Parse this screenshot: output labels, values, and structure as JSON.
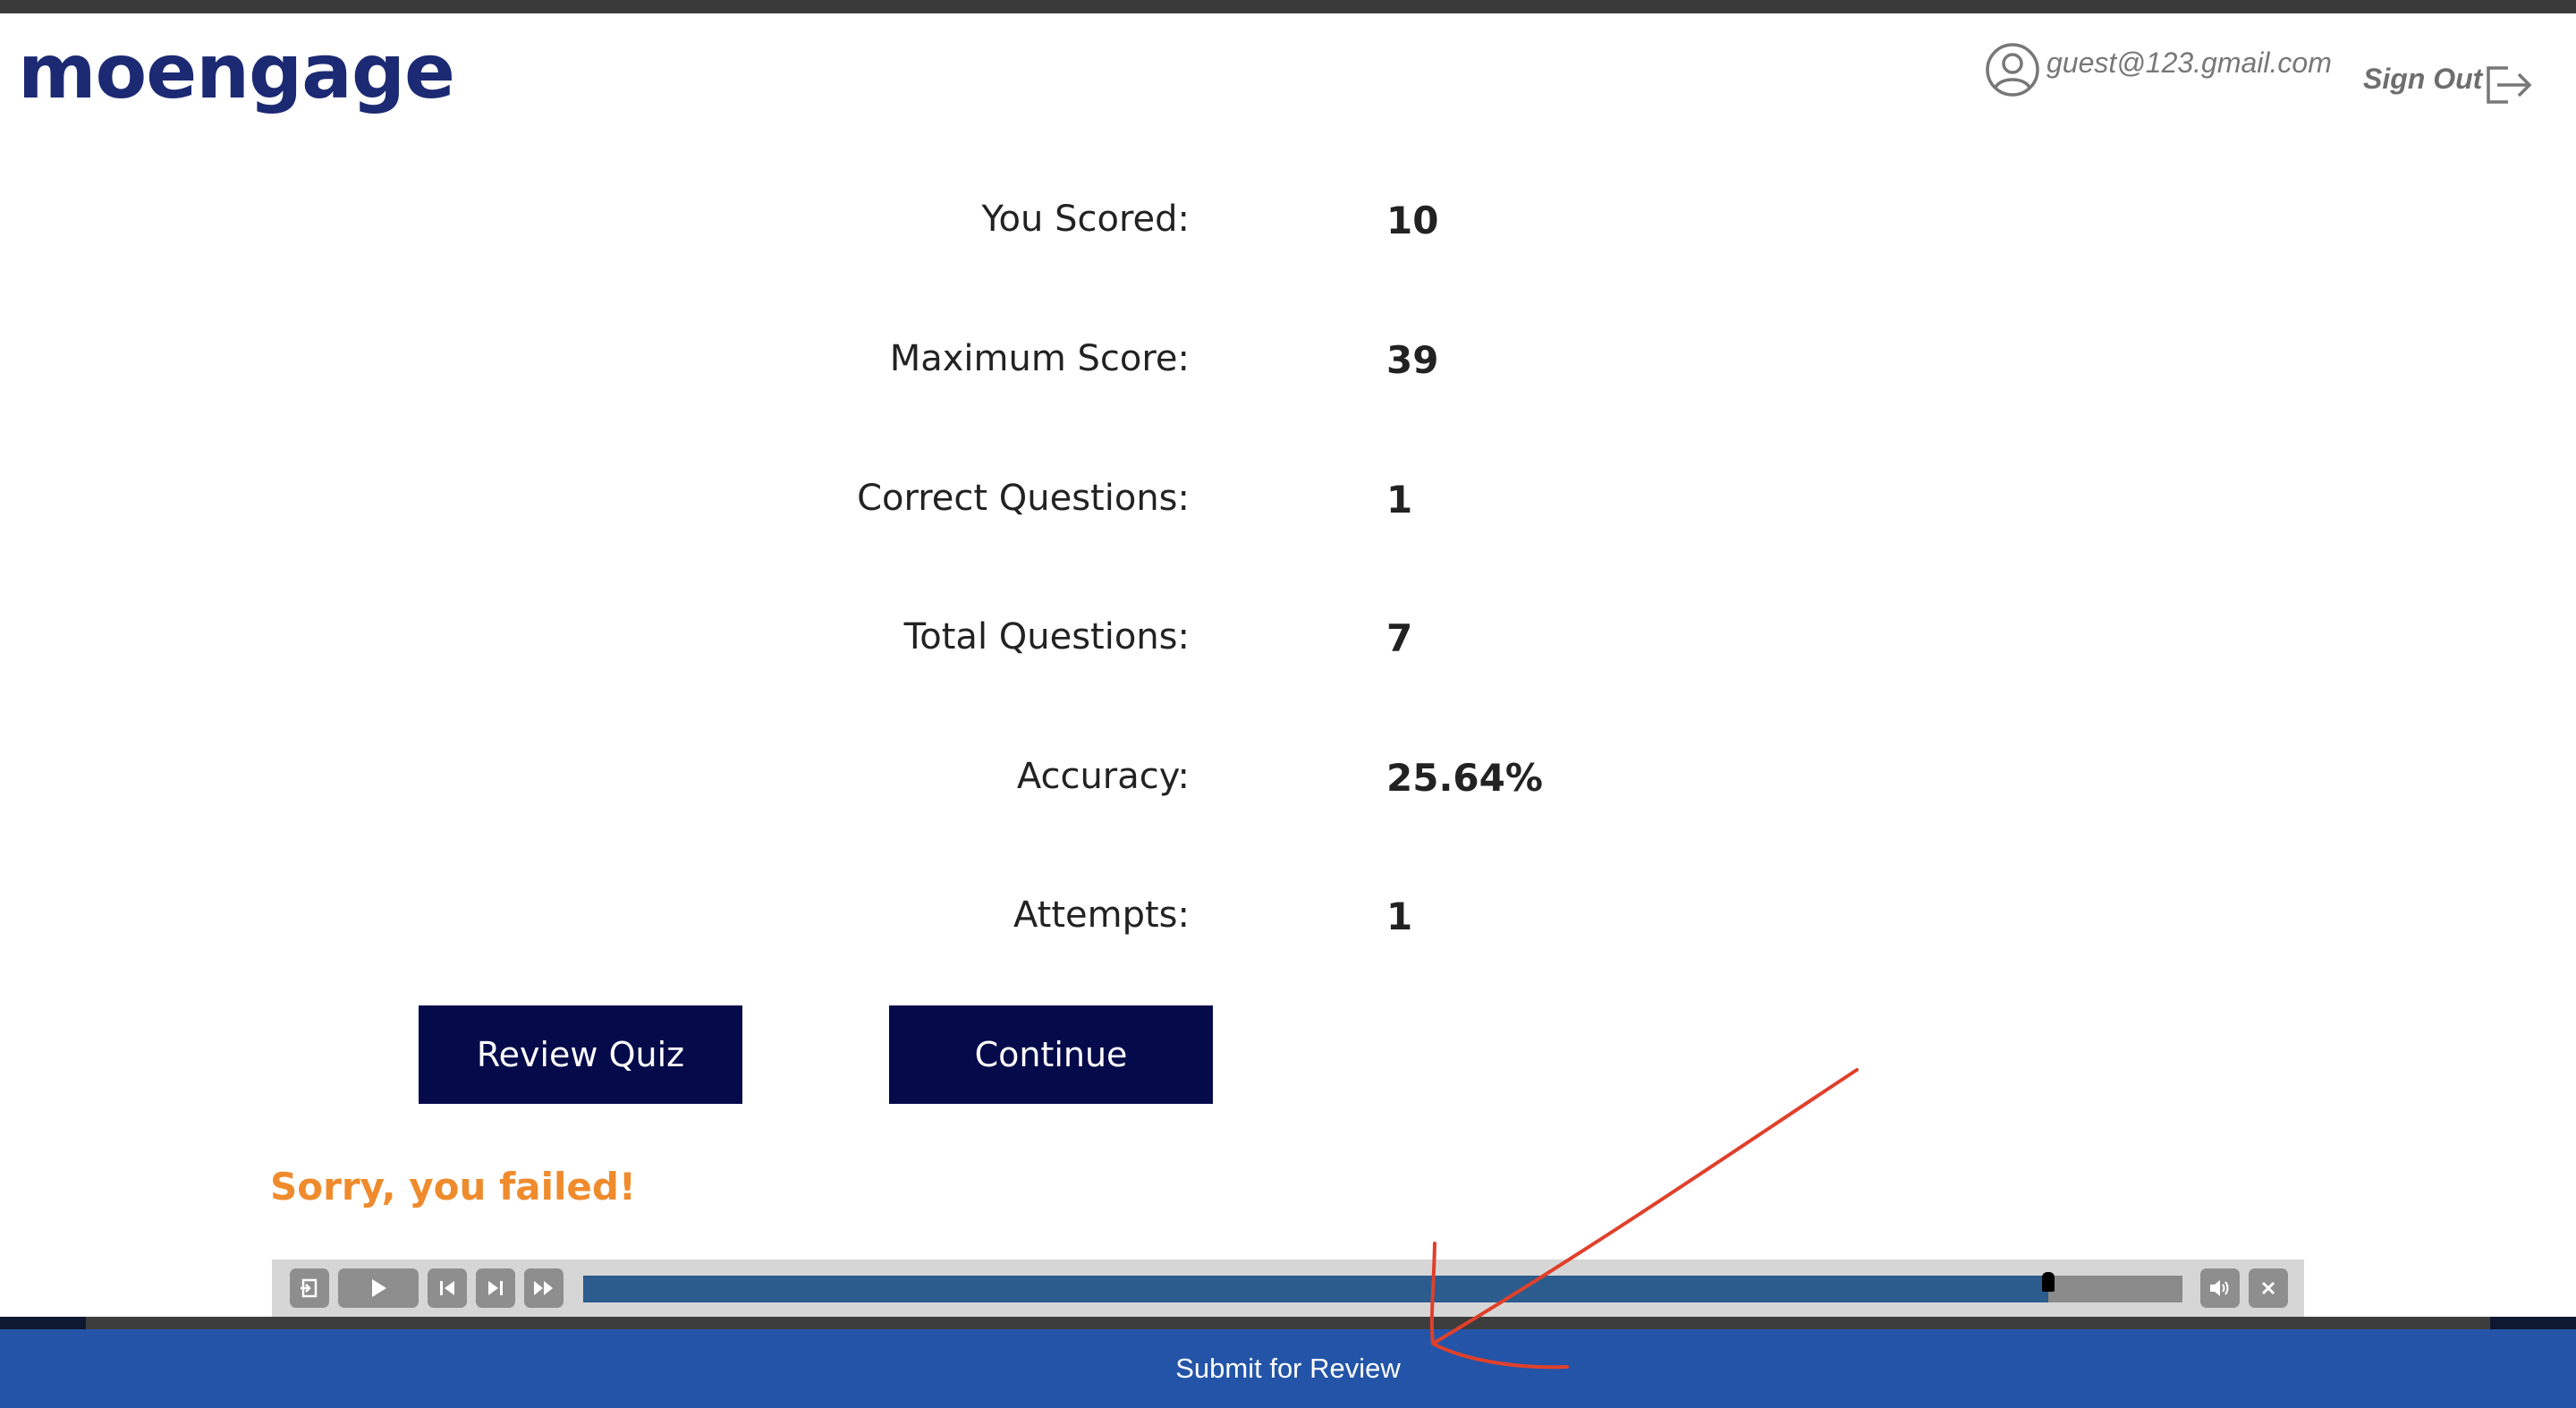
{
  "header": {
    "logo_text": "moengage",
    "user_email": "guest@123.gmail.com",
    "sign_out_label": "Sign Out",
    "icons": {
      "user": "user-circle-icon",
      "sign_out": "sign-out-icon"
    }
  },
  "results": [
    {
      "label": "You Scored:",
      "value": "10"
    },
    {
      "label": "Maximum Score:",
      "value": "39"
    },
    {
      "label": "Correct Questions:",
      "value": "1"
    },
    {
      "label": "Total Questions:",
      "value": "7"
    },
    {
      "label": "Accuracy:",
      "value": "25.64%"
    },
    {
      "label": "Attempts:",
      "value": "1"
    }
  ],
  "actions": {
    "review_quiz_label": "Review Quiz",
    "continue_label": "Continue"
  },
  "status": {
    "message": "Sorry, you failed!",
    "color": "#ef8b2c"
  },
  "player": {
    "progress": 0.916,
    "icons": [
      "exit-icon",
      "play-icon",
      "skip-back-icon",
      "skip-forward-icon",
      "fast-forward-icon",
      "volume-icon",
      "close-icon"
    ]
  },
  "footer": {
    "submit_label": "Submit for Review"
  },
  "colors": {
    "brand": "#1c2a73",
    "button": "#050a4a",
    "submit_bar": "#2354a8",
    "progress_fill": "#2c5b8e",
    "annotation": "#e0402a"
  }
}
